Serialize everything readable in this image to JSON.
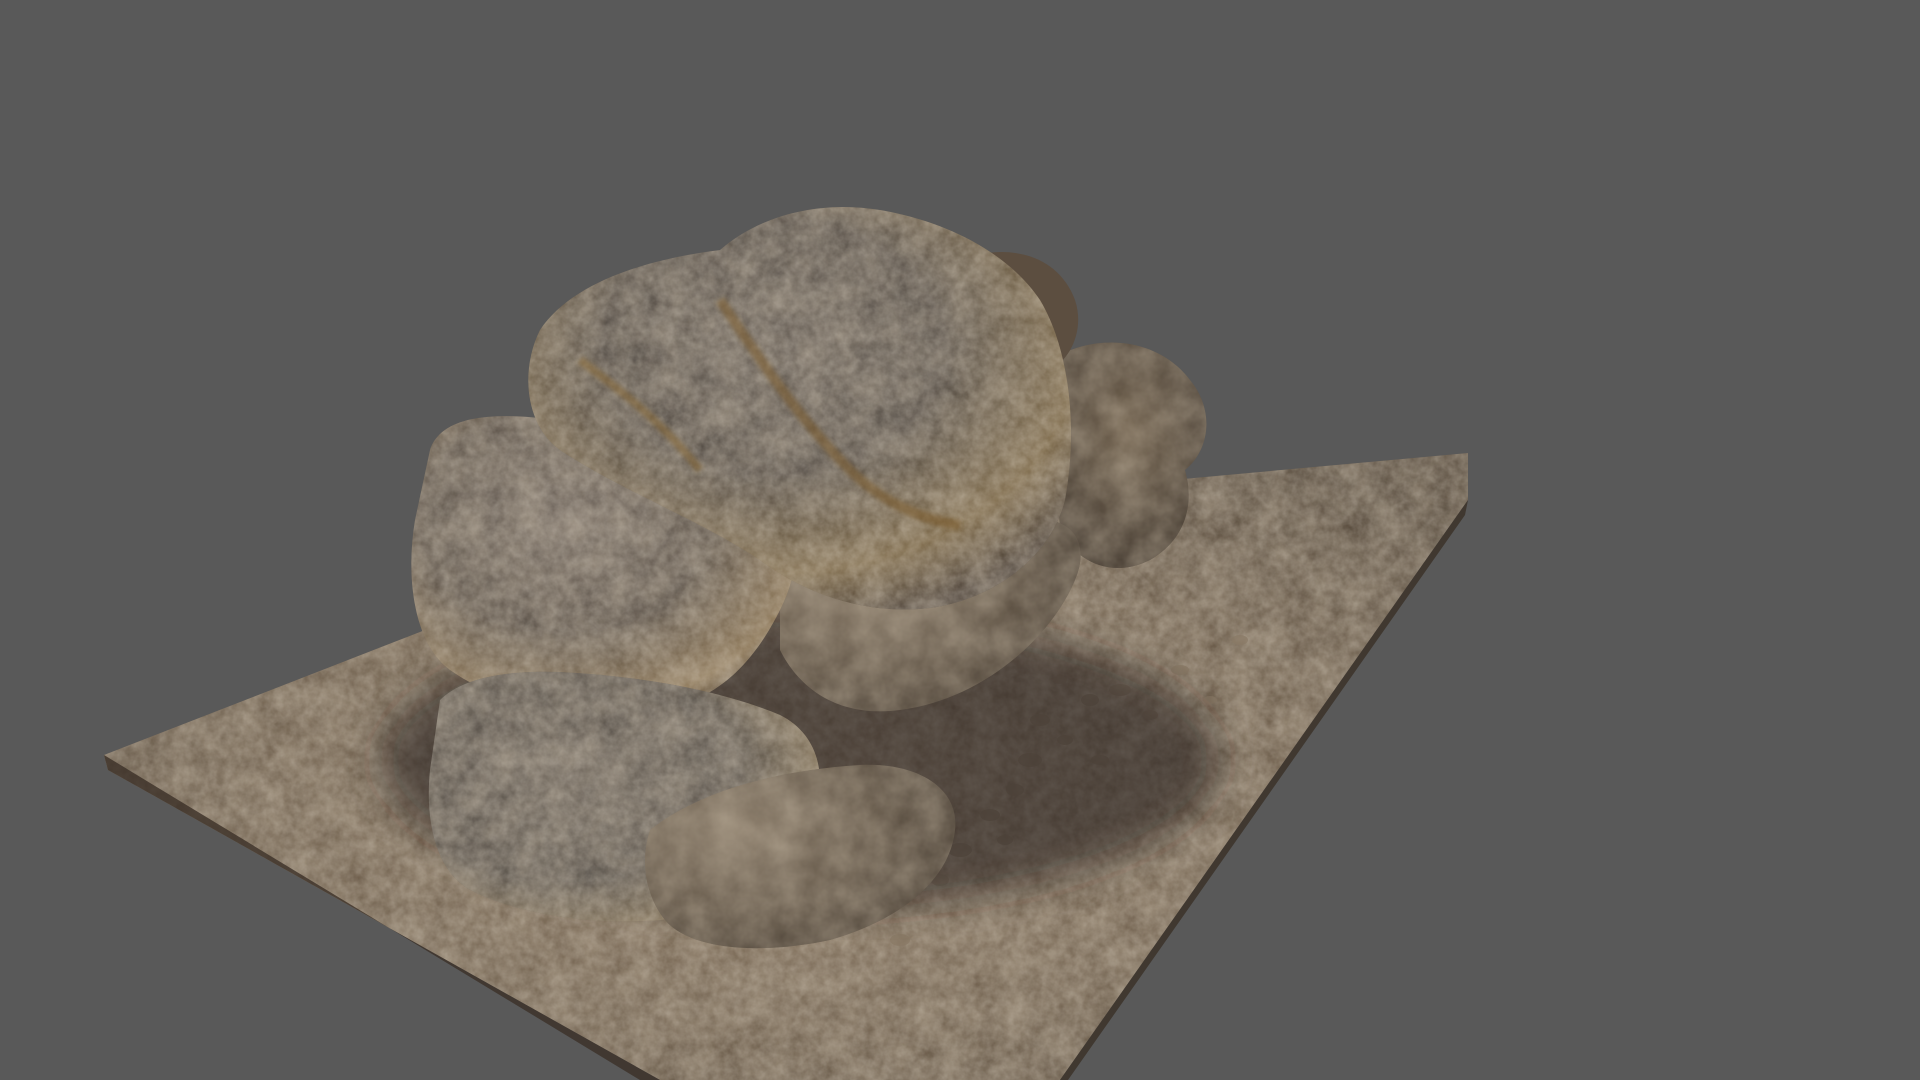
{
  "viewport": {
    "background_color": "#595959"
  },
  "model": {
    "subject": "rock-formation-on-ground-tile",
    "base_color": "#6b5a46",
    "rock_colors": {
      "dark": "#3a342f",
      "mid": "#6a5c4c",
      "light": "#9a8b78",
      "ochre": "#8a6a3a"
    },
    "ground_colors": {
      "dark": "#4a3d30",
      "mid": "#6e5c48",
      "light": "#9c8a74"
    }
  }
}
